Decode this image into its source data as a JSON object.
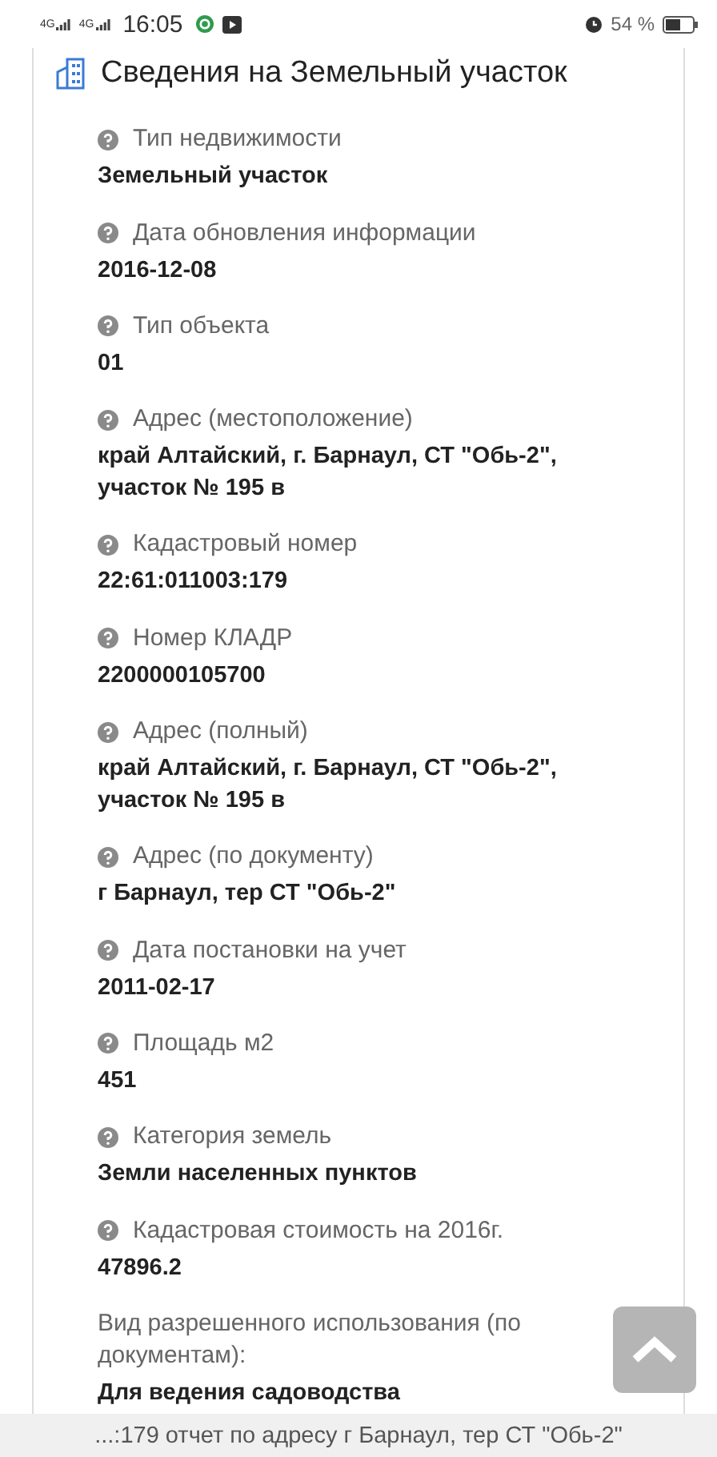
{
  "status_bar": {
    "time": "16:05",
    "signal_labels": [
      "4G",
      "4G"
    ],
    "battery": "54 %"
  },
  "card": {
    "title": "Сведения на Земельный участок",
    "fields": [
      {
        "label": "Тип недвижимости",
        "value": "Земельный участок",
        "kind": "help"
      },
      {
        "label": "Дата обновления информации",
        "value": "2016-12-08",
        "kind": "help"
      },
      {
        "label": "Тип объекта",
        "value": "01",
        "kind": "help"
      },
      {
        "label": "Адрес (местоположение)",
        "value": "край Алтайский, г. Барнаул, СТ \"Обь-2\", участок № 195 в",
        "kind": "help"
      },
      {
        "label": "Кадастровый номер",
        "value": "22:61:011003:179",
        "kind": "help"
      },
      {
        "label": "Номер КЛАДР",
        "value": "2200000105700",
        "kind": "help"
      },
      {
        "label": "Адрес (полный)",
        "value": "край Алтайский, г. Барнаул, СТ \"Обь-2\", участок № 195 в",
        "kind": "help"
      },
      {
        "label": "Адрес (по документу)",
        "value": "г Барнаул, тер СТ \"Обь-2\"",
        "kind": "help"
      },
      {
        "label": "Дата постановки на учет",
        "value": "2011-02-17",
        "kind": "help"
      },
      {
        "label": "Площадь м2",
        "value": "451",
        "kind": "help"
      },
      {
        "label": "Категория земель",
        "value": "Земли населенных пунктов",
        "kind": "help"
      },
      {
        "label": "Кадастровая стоимость на 2016г.",
        "value": "47896.2",
        "kind": "help"
      },
      {
        "label": "Вид разрешенного использования (по документам):",
        "value": "Для ведения садоводства",
        "kind": "plain"
      }
    ]
  },
  "bottom_bar": {
    "text": "...:179 отчет по адресу г Барнаул, тер СТ \"Обь-2\""
  }
}
